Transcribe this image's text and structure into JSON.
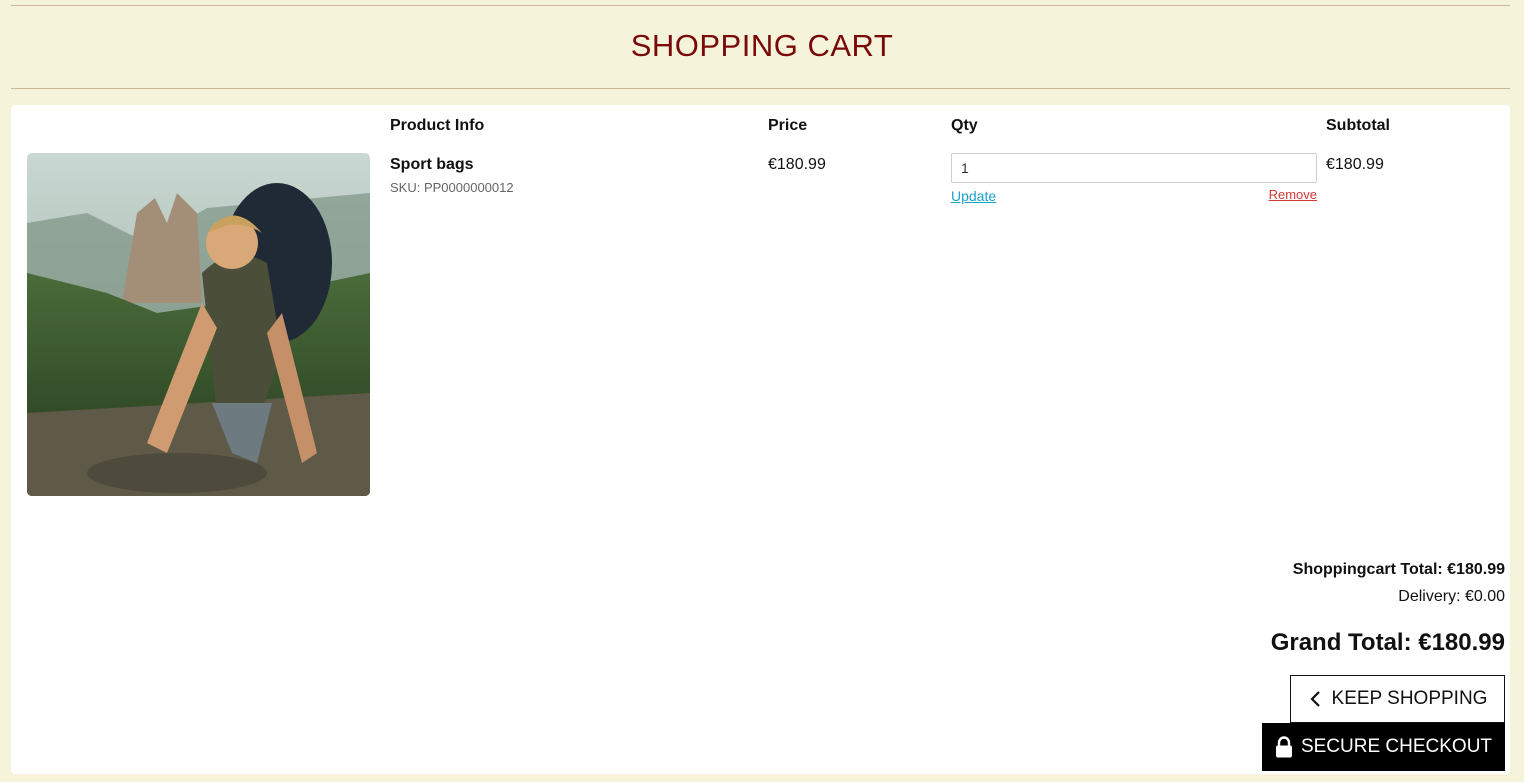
{
  "page": {
    "title": "SHOPPING CART"
  },
  "table": {
    "headers": {
      "product_info": "Product Info",
      "price": "Price",
      "qty": "Qty",
      "subtotal": "Subtotal"
    }
  },
  "items": [
    {
      "name": "Sport bags",
      "sku": "SKU: PP0000000012",
      "price": "€180.99",
      "qty": "1",
      "update_label": "Update",
      "remove_label": "Remove",
      "subtotal": "€180.99",
      "image_icon": "product-photo"
    }
  ],
  "totals": {
    "cart_total": "Shoppingcart Total: €180.99",
    "delivery": "Delivery: €0.00",
    "grand_total": "Grand Total: €180.99"
  },
  "buttons": {
    "keep_shopping": "KEEP SHOPPING",
    "secure_checkout": "SECURE CHECKOUT"
  },
  "colors": {
    "background": "#f5f3da",
    "title": "#7a0a0a",
    "update_link": "#17a2c8",
    "remove_link": "#d13a3a",
    "checkout_button": "#000000"
  }
}
